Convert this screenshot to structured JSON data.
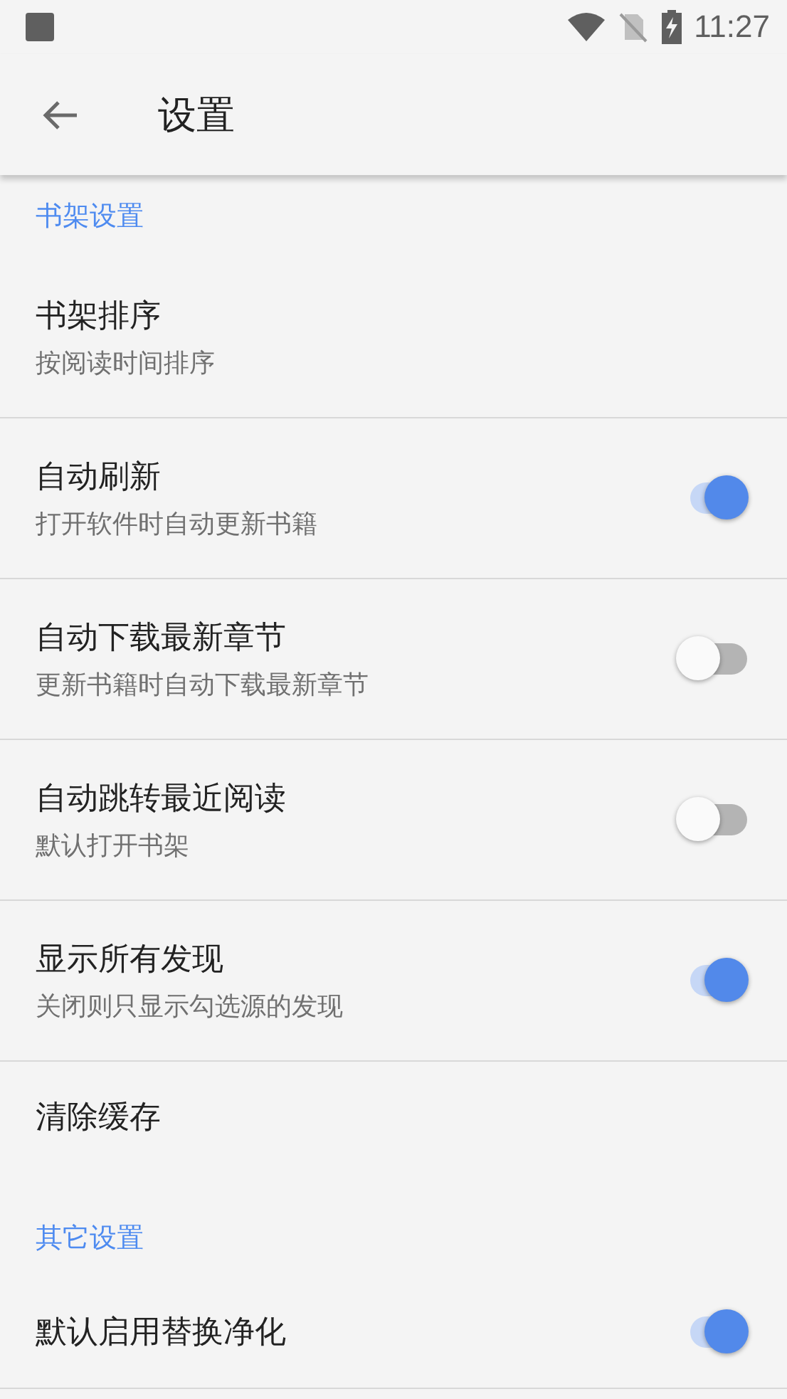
{
  "status_bar": {
    "time": "11:27"
  },
  "toolbar": {
    "title": "设置"
  },
  "sections": [
    {
      "header": "书架设置",
      "items": [
        {
          "kind": "plain",
          "title": "书架排序",
          "subtitle": "按阅读时间排序"
        },
        {
          "kind": "toggle",
          "title": "自动刷新",
          "subtitle": "打开软件时自动更新书籍",
          "on": true
        },
        {
          "kind": "toggle",
          "title": "自动下载最新章节",
          "subtitle": "更新书籍时自动下载最新章节",
          "on": false
        },
        {
          "kind": "toggle",
          "title": "自动跳转最近阅读",
          "subtitle": "默认打开书架",
          "on": false
        },
        {
          "kind": "toggle",
          "title": "显示所有发现",
          "subtitle": "关闭则只显示勾选源的发现",
          "on": true
        },
        {
          "kind": "plain",
          "title": "清除缓存"
        }
      ]
    },
    {
      "header": "其它设置",
      "items": [
        {
          "kind": "toggle",
          "title": "默认启用替换净化",
          "on": true
        }
      ]
    }
  ]
}
